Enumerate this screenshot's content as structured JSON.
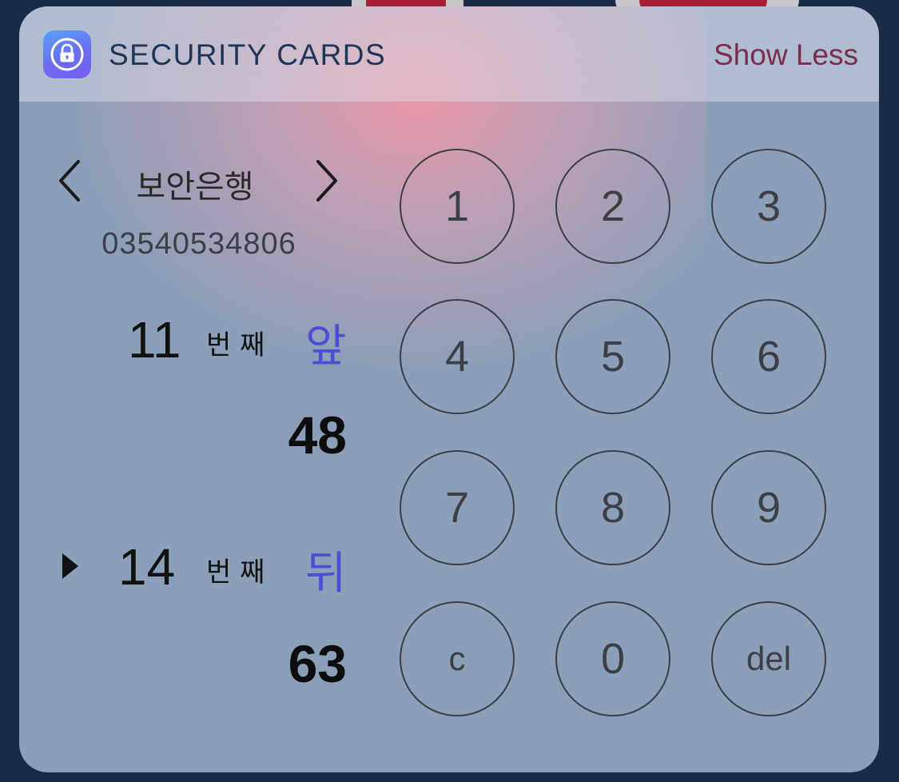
{
  "header": {
    "app_icon": "lock-icon",
    "title": "SECURITY CARDS",
    "show_less_label": "Show Less"
  },
  "bank": {
    "prev_icon": "chevron-left-icon",
    "next_icon": "chevron-right-icon",
    "name": "보안은행",
    "account_number": "03540534806"
  },
  "codes": [
    {
      "index": "11",
      "unit": "번 째",
      "side": "앞",
      "value": "48",
      "selected": false
    },
    {
      "index": "14",
      "unit": "번 째",
      "side": "뒤",
      "value": "63",
      "selected": true
    }
  ],
  "keypad": {
    "keys": [
      "1",
      "2",
      "3",
      "4",
      "5",
      "6",
      "7",
      "8",
      "9",
      "c",
      "0",
      "del"
    ]
  },
  "colors": {
    "title": "#1f3558",
    "show_less": "#7a2d4c",
    "side_label": "#4b4fd8",
    "panel": "#8c9fb8"
  }
}
